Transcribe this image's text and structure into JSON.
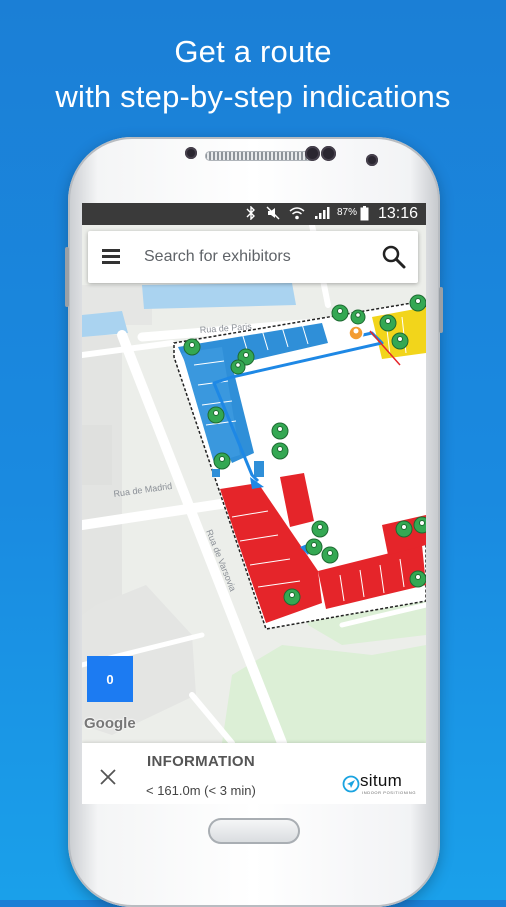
{
  "headline": {
    "line1": "Get a route",
    "line2": "with step-by-step indications"
  },
  "status_bar": {
    "battery_percent": "87%",
    "time": "13:16",
    "icons": [
      "bluetooth-icon",
      "mute-icon",
      "wifi-icon",
      "signal-icon",
      "battery-icon"
    ]
  },
  "search": {
    "placeholder": "Search for exhibitors",
    "value": ""
  },
  "map": {
    "streets": [
      "Rua de Paris",
      "Rua de Madrid",
      "Rua de Varsovia"
    ],
    "route_color": "#1e88e5",
    "floor_button": "0",
    "attribution": "Google"
  },
  "info_panel": {
    "title": "INFORMATION",
    "distance": "< 161.0m (< 3 min)"
  },
  "brand": {
    "name": "situm",
    "tagline": "INDOOR POSITIONING"
  },
  "colors": {
    "background": "#1a8ae0",
    "poi_marker": "#34a853",
    "hall_blue": "#2f8fd8",
    "hall_red": "#e5252a",
    "hall_yellow": "#f2d51b",
    "floor_button": "#1c7bf2"
  }
}
